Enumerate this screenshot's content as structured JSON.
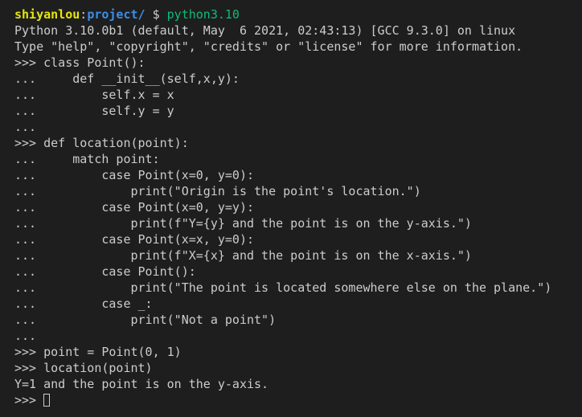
{
  "prompt": {
    "user": "shiyanlou",
    "separator": ":",
    "path": "project/",
    "dollar": " $ ",
    "command": "python3.10"
  },
  "session_lines": [
    "Python 3.10.0b1 (default, May  6 2021, 02:43:13) [GCC 9.3.0] on linux",
    "Type \"help\", \"copyright\", \"credits\" or \"license\" for more information.",
    ">>> class Point():",
    "...     def __init__(self,x,y):",
    "...         self.x = x",
    "...         self.y = y",
    "...",
    ">>> def location(point):",
    "...     match point:",
    "...         case Point(x=0, y=0):",
    "...             print(\"Origin is the point's location.\")",
    "...         case Point(x=0, y=y):",
    "...             print(f\"Y={y} and the point is on the y-axis.\")",
    "...         case Point(x=x, y=0):",
    "...             print(f\"X={x} and the point is on the x-axis.\")",
    "...         case Point():",
    "...             print(\"The point is located somewhere else on the plane.\")",
    "...         case _:",
    "...             print(\"Not a point\")",
    "...",
    ">>> point = Point(0, 1)",
    ">>> location(point)",
    "Y=1 and the point is on the y-axis."
  ],
  "final_prompt": ">>> "
}
